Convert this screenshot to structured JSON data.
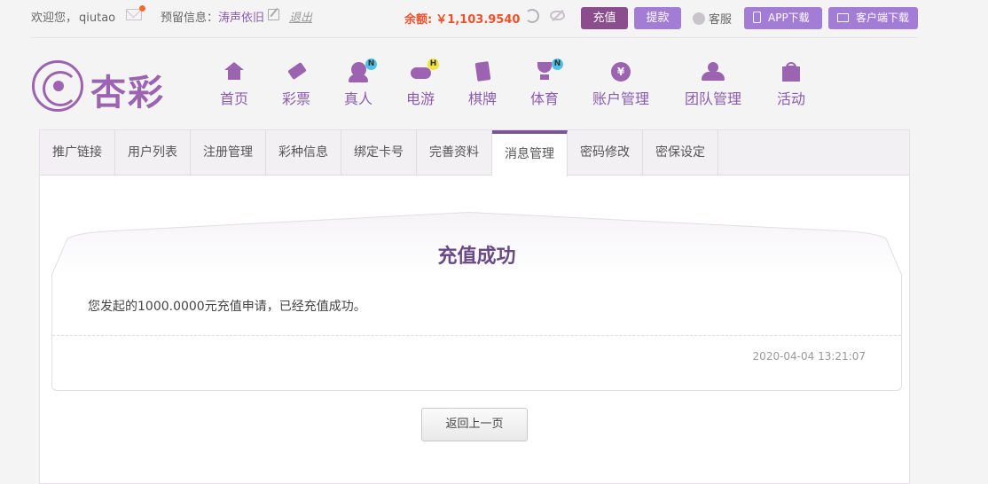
{
  "topbar": {
    "welcome": "欢迎您，",
    "username": "qiutao",
    "reserve_label": "预留信息：",
    "reserve_value": "涛声依旧",
    "logout": "退出",
    "balance_label": "余额:",
    "balance_value": "￥1,103.9540",
    "recharge": "充值",
    "withdraw": "提款",
    "service": "客服",
    "app_download": "APP下载",
    "client_download": "客户端下载",
    "colors": {
      "balance": "#f0502a",
      "recharge_bg": "#8c4d8e",
      "accent": "#a37cd6"
    }
  },
  "logo": {
    "text": "杏彩"
  },
  "nav": [
    {
      "label": "首页",
      "icon": "home-icon"
    },
    {
      "label": "彩票",
      "icon": "ticket-icon"
    },
    {
      "label": "真人",
      "icon": "live-dealer-icon",
      "badge": "N"
    },
    {
      "label": "电游",
      "icon": "gamepad-icon",
      "badge": "H"
    },
    {
      "label": "棋牌",
      "icon": "cards-icon"
    },
    {
      "label": "体育",
      "icon": "trophy-icon",
      "badge": "N"
    },
    {
      "label": "账户管理",
      "icon": "yen-coin-icon"
    },
    {
      "label": "团队管理",
      "icon": "team-icon"
    },
    {
      "label": "活动",
      "icon": "gift-icon"
    }
  ],
  "tabs": [
    {
      "label": "推广链接"
    },
    {
      "label": "用户列表"
    },
    {
      "label": "注册管理"
    },
    {
      "label": "彩种信息"
    },
    {
      "label": "绑定卡号"
    },
    {
      "label": "完善资料"
    },
    {
      "label": "消息管理",
      "active": true
    },
    {
      "label": "密码修改"
    },
    {
      "label": "密保设定"
    }
  ],
  "message": {
    "title": "充值成功",
    "body": "您发起的1000.0000元充值申请，已经充值成功。",
    "date": "2020-04-04 13:21:07"
  },
  "back_button": "返回上一页"
}
